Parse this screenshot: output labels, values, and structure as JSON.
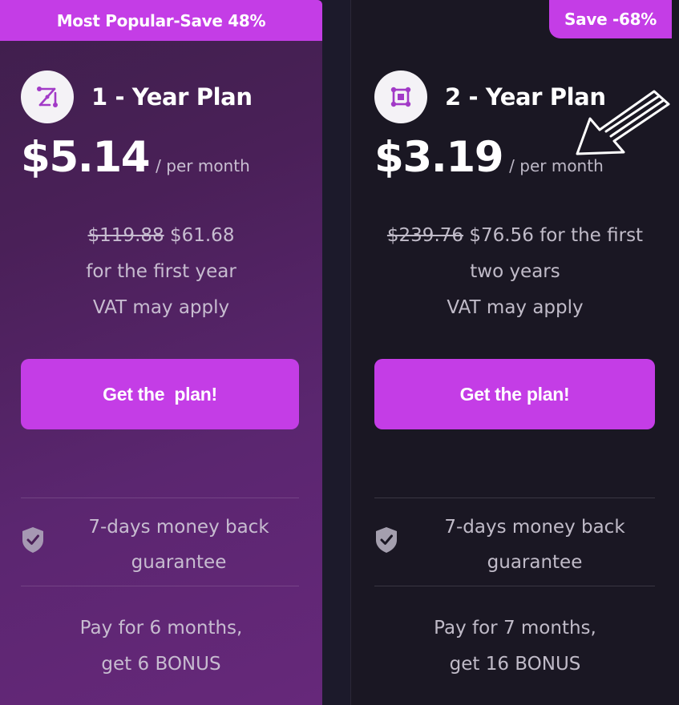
{
  "plans": [
    {
      "ribbon": "Most Popular-Save 48%",
      "name": "1 - Year Plan",
      "icon": "nodes-diagonal-icon",
      "price": "$5.14",
      "per": "/ per month",
      "original_price": "$119.88",
      "discount_price": "$61.68",
      "terms_line1": "for the first year",
      "vat": "VAT may apply",
      "cta": "Get the  plan!",
      "guarantee_line1": "7-days money back",
      "guarantee_line2": "guarantee",
      "bonus_line1": "Pay for 6 months,",
      "bonus_line2": "get 6 BONUS"
    },
    {
      "badge": "Save -68%",
      "name": "2 - Year Plan",
      "icon": "nodes-square-icon",
      "price": "$3.19",
      "per": "/ per month",
      "original_price": "$239.76",
      "discount_price": "$76.56",
      "terms_line1": "for the first",
      "terms_line2": "two years",
      "vat": "VAT may apply",
      "cta": "Get the plan!",
      "guarantee_line1": "7-days money back",
      "guarantee_line2": "guarantee",
      "bonus_line1": "Pay for 7 months,",
      "bonus_line2": "get 16 BONUS"
    }
  ],
  "colors": {
    "accent": "#c43de6",
    "card1_bg": "#5b2670",
    "card2_bg": "#1a1723",
    "page_bg": "#1c1a2b"
  }
}
